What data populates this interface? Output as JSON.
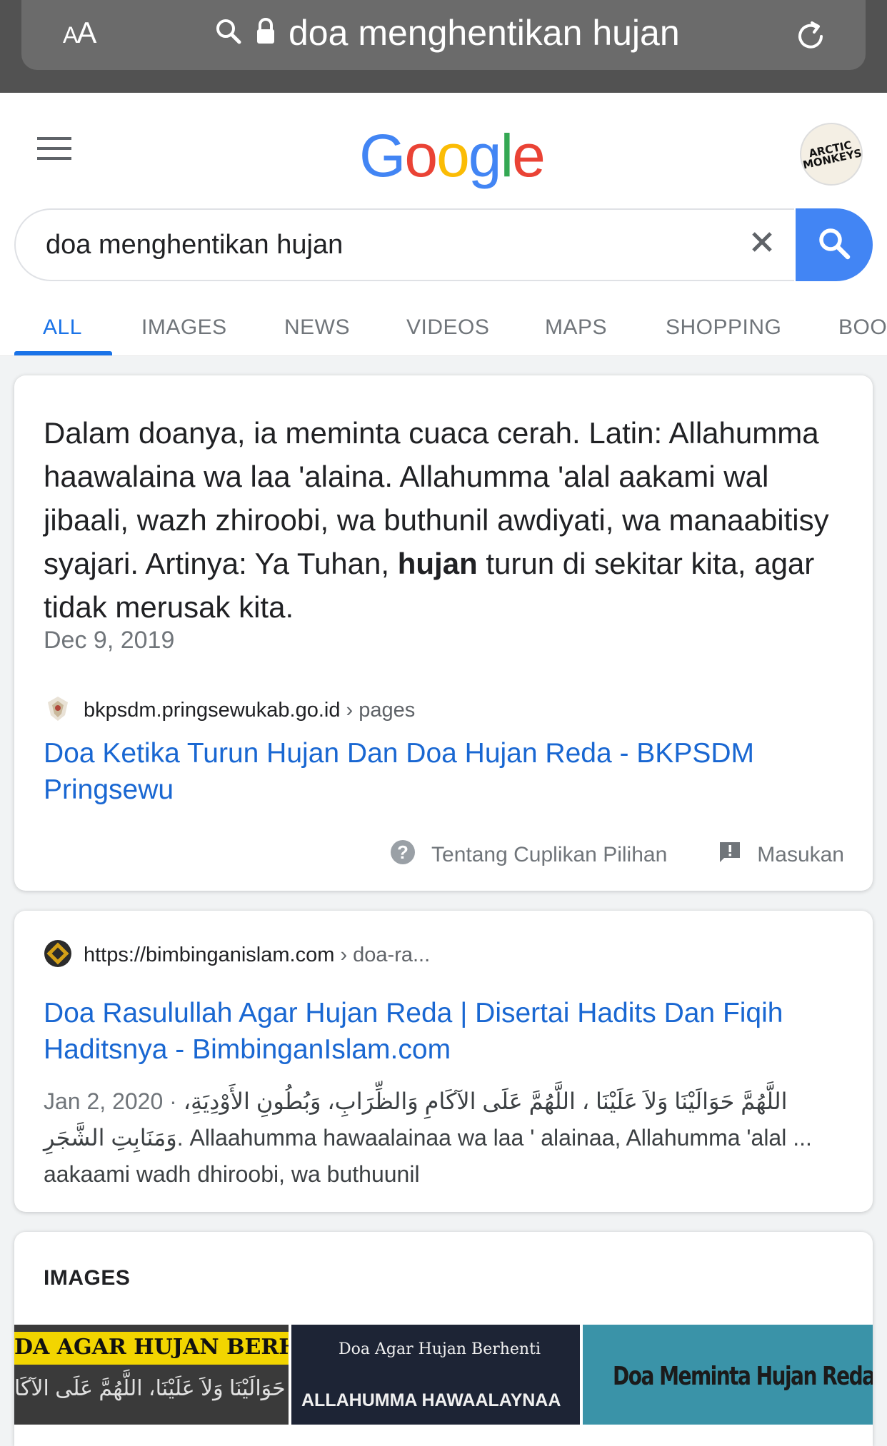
{
  "browser": {
    "aa_label_small": "A",
    "aa_label_big": "A",
    "url": "doa menghentikan hujan"
  },
  "google": {
    "logo_letters": [
      "G",
      "o",
      "o",
      "g",
      "l",
      "e"
    ],
    "avatar_text": "ARCTIC MONKEYS",
    "search_value": "doa menghentikan hujan",
    "tabs": [
      {
        "label": "ALL",
        "active": true
      },
      {
        "label": "IMAGES"
      },
      {
        "label": "NEWS"
      },
      {
        "label": "VIDEOS"
      },
      {
        "label": "MAPS"
      },
      {
        "label": "SHOPPING"
      },
      {
        "label": "BOO"
      }
    ]
  },
  "featured_snippet": {
    "text_before": "Dalam doanya, ia meminta cuaca cerah. Latin: Allahumma haawalaina wa laa 'alaina. Allahumma 'alal aakami wal jibaali, wazh zhiroobi, wa buthunil awdiyati, wa manaabitisy syajari. Artinya: Ya Tuhan, ",
    "text_bold": "hujan",
    "text_after": " turun di sekitar kita, agar tidak merusak kita.",
    "date": "Dec 9, 2019",
    "site": "bkpsdm.pringsewukab.go.id",
    "crumb": "› pages",
    "title": "Doa Ketika Turun Hujan Dan Doa Hujan Reda - BKPSDM Pringsewu",
    "about_label": "Tentang Cuplikan Pilihan",
    "feedback_label": "Masukan"
  },
  "result2": {
    "site": "https://bimbinganislam.com",
    "crumb": "› doa-ra...",
    "title": "Doa Rasulullah Agar Hujan Reda | Disertai Hadits Dan Fiqih Haditsnya - BimbinganIslam.com",
    "date": "Jan 2, 2020 · ",
    "snippet_arabic": "اللَّهُمَّ حَوَالَيْنَا وَلاَ عَلَيْنَا ، اللَّهُمَّ عَلَى الآكَامِ وَالظِّرَابِ، وَبُطُونِ الأَوْدِيَةِ، وَمَنَابِتِ الشَّجَرِ.",
    "snippet_latin": "Allaahumma hawaalainaa wa laa ' alainaa, Allahumma 'alal ... aakaami wadh dhiroobi, wa buthuunil"
  },
  "images_section": {
    "heading": "IMAGES",
    "thumbs": [
      {
        "text": "DA AGAR HUJAN BERHEN",
        "sub": "حَوَالَيْنَا وَلاَ عَلَيْنَا، اللَّهُمَّ عَلَى الآكَا"
      },
      {
        "text": "Doa Agar Hujan Berhenti",
        "sub": "ALLAHUMMA HAWAALAYNAA"
      },
      {
        "text": "Doa Meminta Hujan Reda",
        "sub": ""
      }
    ]
  },
  "colors": {
    "link": "#1967d2",
    "accent": "#1a73e8",
    "search_button": "#4285f4"
  }
}
